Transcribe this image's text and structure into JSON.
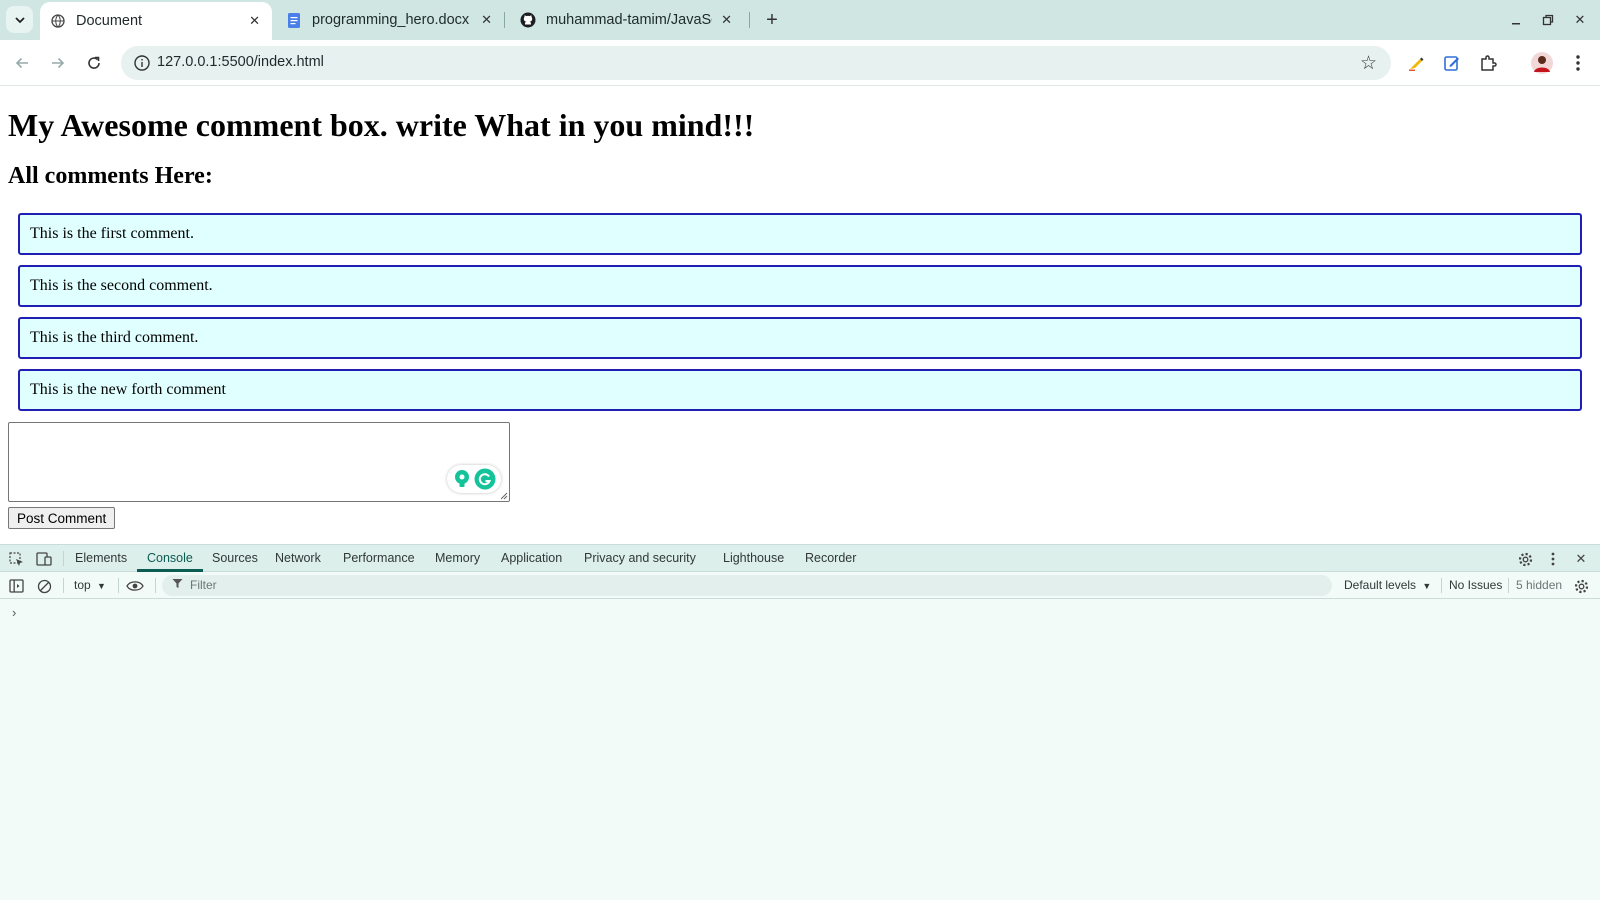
{
  "browser": {
    "tabs": [
      {
        "title": "Document",
        "favicon": "globe-icon",
        "active": true
      },
      {
        "title": "programming_hero.docx",
        "favicon": "docs-icon",
        "active": false
      },
      {
        "title": "muhammad-tamim/JavaScript",
        "favicon": "github-icon",
        "active": false
      }
    ],
    "new_tab_label": "+",
    "url": "127.0.0.1:5500/index.html"
  },
  "page": {
    "heading": "My Awesome comment box. write What in you mind!!!",
    "subheading": "All comments Here:",
    "comments": [
      "This is the first comment.",
      "This is the second comment.",
      "This is the third comment.",
      "This is the new forth comment"
    ],
    "comment_input_value": "",
    "post_button_label": "Post Comment",
    "comment_bg_color": "#e0ffff",
    "comment_border_color": "#1f1fb3"
  },
  "devtools": {
    "tabs": [
      "Elements",
      "Console",
      "Sources",
      "Network",
      "Performance",
      "Memory",
      "Application",
      "Privacy and security",
      "Lighthouse",
      "Recorder"
    ],
    "active_tab": "Console",
    "context": "top",
    "filter_placeholder": "Filter",
    "levels_label": "Default levels",
    "issues_label": "No Issues",
    "hidden_label": "5 hidden",
    "prompt_symbol": "›"
  }
}
